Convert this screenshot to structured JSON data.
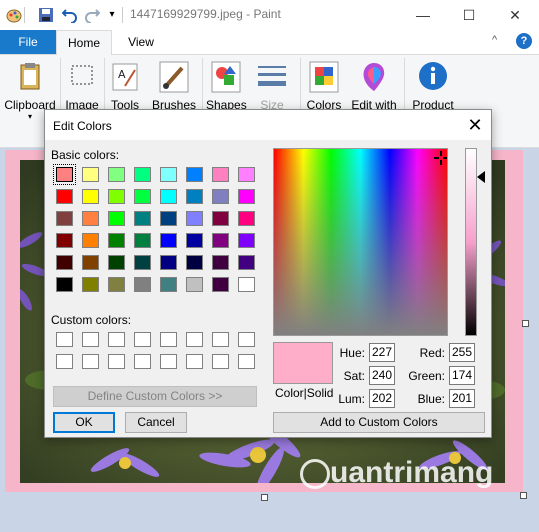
{
  "window": {
    "title": "1447169929799.jpeg - Paint",
    "minimize": "—",
    "maximize": "☐",
    "close": "✕"
  },
  "ribbon": {
    "tabs": [
      {
        "label": "File"
      },
      {
        "label": "Home"
      },
      {
        "label": "View"
      }
    ],
    "groups": [
      {
        "label": "Clipboard",
        "icon": "clipboard-icon"
      },
      {
        "label": "Image",
        "icon": "image-select-icon"
      },
      {
        "label": "Tools",
        "icon": "tools-icon"
      },
      {
        "label": "Brushes",
        "icon": "brush-icon"
      },
      {
        "label": "Shapes",
        "icon": "shapes-icon"
      },
      {
        "label": "Size",
        "icon": "size-lines-icon"
      },
      {
        "label": "Colors",
        "icon": "colors-palette-icon"
      },
      {
        "label": "Edit with",
        "icon": "paint3d-icon"
      },
      {
        "label": "Product",
        "icon": "info-icon"
      }
    ],
    "help_icon": "?",
    "collapse_icon": "^"
  },
  "dialog": {
    "title": "Edit Colors",
    "basic_colors_label": "Basic colors:",
    "custom_colors_label": "Custom colors:",
    "basic_colors": [
      "#ff8080",
      "#ffff80",
      "#80ff80",
      "#00ff80",
      "#80ffff",
      "#0080ff",
      "#ff80c0",
      "#ff80ff",
      "#ff0000",
      "#ffff00",
      "#80ff00",
      "#00ff40",
      "#00ffff",
      "#0080c0",
      "#8080c0",
      "#ff00ff",
      "#804040",
      "#ff8040",
      "#00ff00",
      "#008080",
      "#004080",
      "#8080ff",
      "#800040",
      "#ff0080",
      "#800000",
      "#ff8000",
      "#008000",
      "#008040",
      "#0000ff",
      "#0000a0",
      "#800080",
      "#8000ff",
      "#400000",
      "#804000",
      "#004000",
      "#004040",
      "#000080",
      "#000040",
      "#400040",
      "#400080",
      "#000000",
      "#808000",
      "#808040",
      "#808080",
      "#408080",
      "#c0c0c0",
      "#400040",
      "#ffffff"
    ],
    "selected_swatch": 0,
    "define_button": "Define Custom Colors >>",
    "ok_button": "OK",
    "cancel_button": "Cancel",
    "preview_label": "Color|Solid",
    "add_button": "Add to Custom Colors",
    "hue_label": "Hue:",
    "hue": "227",
    "sat_label": "Sat:",
    "sat": "240",
    "lum_label": "Lum:",
    "lum": "202",
    "red_label": "Red:",
    "red": "255",
    "green_label": "Green:",
    "green": "174",
    "blue_label": "Blue:",
    "blue": "201",
    "current_color": "#ffaec9"
  },
  "watermark": "uantrimang"
}
